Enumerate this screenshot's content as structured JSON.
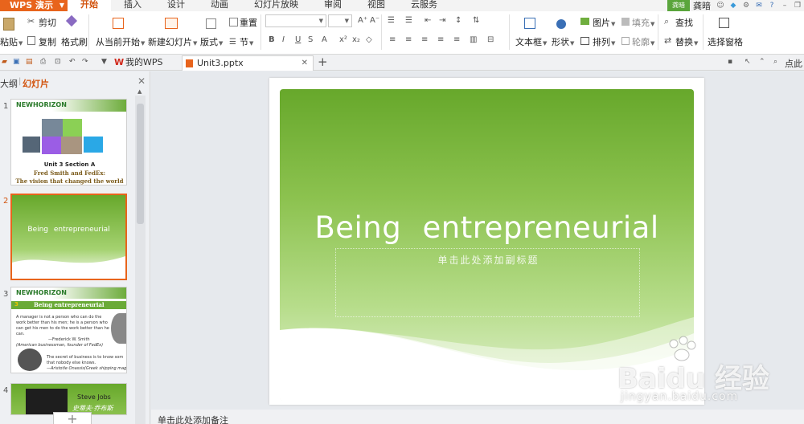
{
  "app": {
    "name": "WPS 演示"
  },
  "menu": {
    "tabs": [
      {
        "label": "开始"
      },
      {
        "label": "插入"
      },
      {
        "label": "设计"
      },
      {
        "label": "动画"
      },
      {
        "label": "幻灯片放映"
      },
      {
        "label": "审阅"
      },
      {
        "label": "视图"
      },
      {
        "label": "云服务"
      }
    ],
    "active_tab": "开始"
  },
  "user": {
    "avatar_text": "龚暗",
    "name": "龚暗"
  },
  "ribbon": {
    "paste": "粘贴",
    "cut": "剪切",
    "copy": "复制",
    "format_painter": "格式刷",
    "from_current": "从当前开始",
    "new_slide": "新建幻灯片",
    "layout": "版式",
    "reset": "重置",
    "section": "节",
    "textbox": "文本框",
    "shape": "形状",
    "picture": "图片",
    "fill": "填充",
    "arrange": "排列",
    "outline": "轮廓",
    "find": "查找",
    "replace": "替换",
    "selection_pane": "选择窗格"
  },
  "tabs": {
    "home_tab": "我的WPS",
    "doc_tab": "Unit3.pptx",
    "comment_hint": "点此记"
  },
  "panel": {
    "outline": "大纲",
    "slides": "幻灯片",
    "thumbs": [
      {
        "num": "1",
        "logo": "NEWHORIZON",
        "title1": "Unit 3 Section A",
        "title2": "Fred Smith and FedEx:",
        "title3": "The vision that changed the world"
      },
      {
        "num": "2",
        "title": "Being   entrepreneurial"
      },
      {
        "num": "3",
        "logo": "NEWHORIZON",
        "unit": "3",
        "heading": "Being entrepreneurial",
        "line1": "A manager is not a person who can do the",
        "line2": "work better than his men; he is a person who",
        "line3": "can get his men to do the work better than he",
        "line4": "can.",
        "quote1": "—Frederick W. Smith",
        "quote1b": "(American businessman, founder of FedEx)",
        "line5": "The secret of business is to know som",
        "line6": "that nobody else knows.",
        "quote2": "—Aristotle Onassis(Greek shipping mag"
      },
      {
        "num": "4",
        "caption": "Steve Jobs",
        "subcaption": "史蒂夫·乔布斯"
      }
    ]
  },
  "slide": {
    "title": "Being   entrepreneurial",
    "subtitle_placeholder": "单击此处添加副标题"
  },
  "status": {
    "notes_hint": "单击此处添加备注"
  },
  "watermark": {
    "brand": "Baidu 经验",
    "url": "jingyan.baidu.com"
  },
  "colors": {
    "accent": "#e8641c",
    "slide_green": "#67a82b"
  }
}
